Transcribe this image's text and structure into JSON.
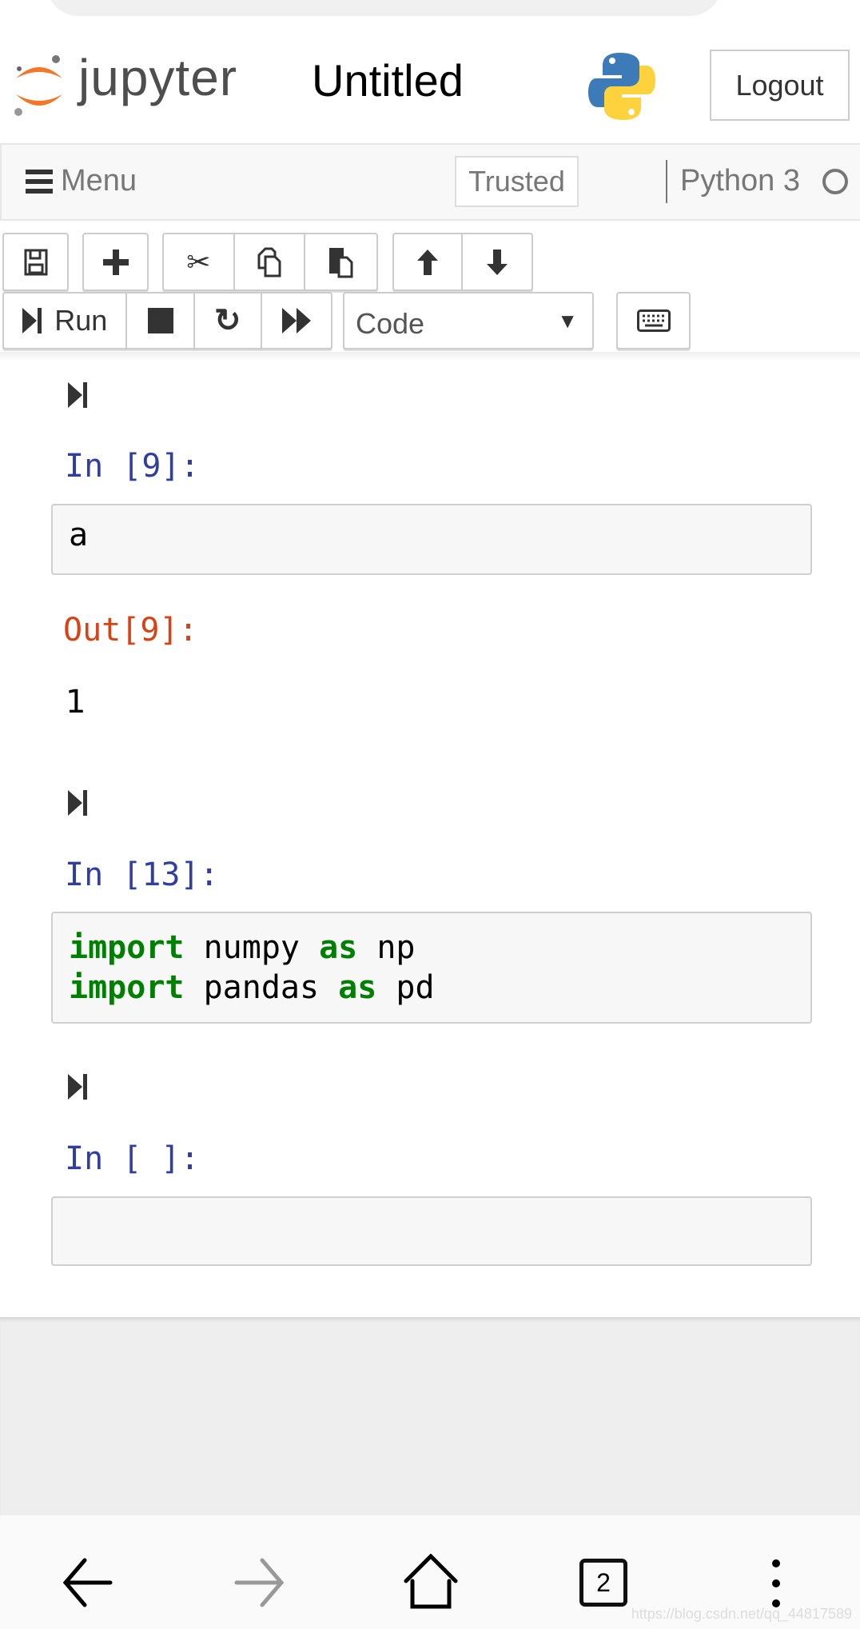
{
  "header": {
    "logo_text": "jupyter",
    "notebook_title": "Untitled",
    "logout_label": "Logout"
  },
  "menubar": {
    "menu_label": "Menu",
    "trusted_label": "Trusted",
    "kernel_name": "Python 3"
  },
  "toolbar": {
    "run_label": "Run",
    "cell_type": "Code"
  },
  "cells": [
    {
      "in_prompt": "In [9]:",
      "code": "a",
      "out_prompt": "Out[9]:",
      "output": "1"
    },
    {
      "in_prompt": "In [13]:",
      "lines": [
        {
          "kw1": "import",
          "mod": " numpy ",
          "kw2": "as",
          "alias": " np"
        },
        {
          "kw1": "import",
          "mod": " pandas ",
          "kw2": "as",
          "alias": " pd"
        }
      ]
    },
    {
      "in_prompt": "In [ ]:",
      "code": ""
    }
  ],
  "browser_nav": {
    "tab_count": "2"
  },
  "watermark": "https://blog.csdn.net/qq_44817589",
  "colors": {
    "in_prompt": "#303f9f",
    "out_prompt": "#d84315",
    "keyword": "#008000",
    "jupyter_orange": "#f37726"
  }
}
